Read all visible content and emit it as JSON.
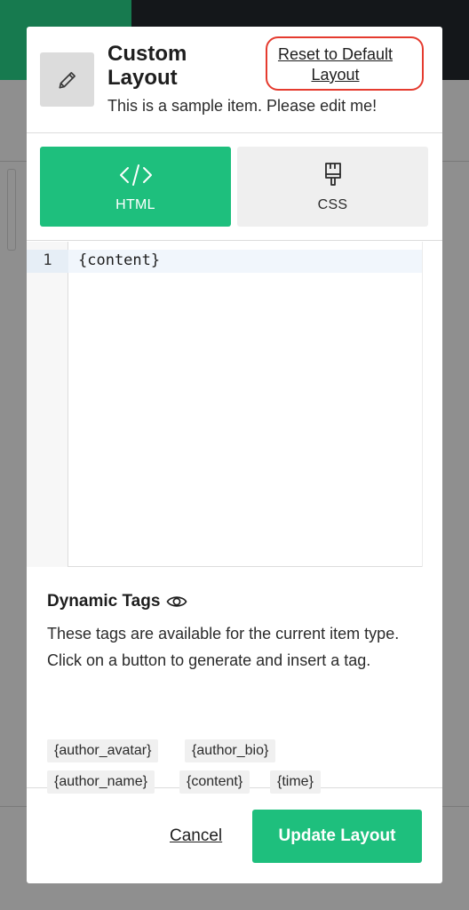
{
  "header": {
    "title": "Custom Layout",
    "subtitle": "This is a sample item. Please edit me!",
    "reset_link": "Reset to Default Layout",
    "icon": "pencil-icon"
  },
  "tabs": [
    {
      "label": "HTML",
      "icon": "code-icon",
      "active": true
    },
    {
      "label": "CSS",
      "icon": "paintbrush-icon",
      "active": false
    }
  ],
  "editor": {
    "line_number": "1",
    "code": "{content}"
  },
  "dynamic_tags": {
    "title": "Dynamic Tags",
    "description": "These tags are available for the current item type. Click on a button to generate and insert a tag.",
    "tags": [
      "{author_avatar}",
      "{author_bio}",
      "{author_name}",
      "{content}",
      "{time}"
    ]
  },
  "footer": {
    "cancel": "Cancel",
    "update": "Update Layout"
  },
  "colors": {
    "accent": "#1ebf7d",
    "highlight": "#e53b2f"
  }
}
